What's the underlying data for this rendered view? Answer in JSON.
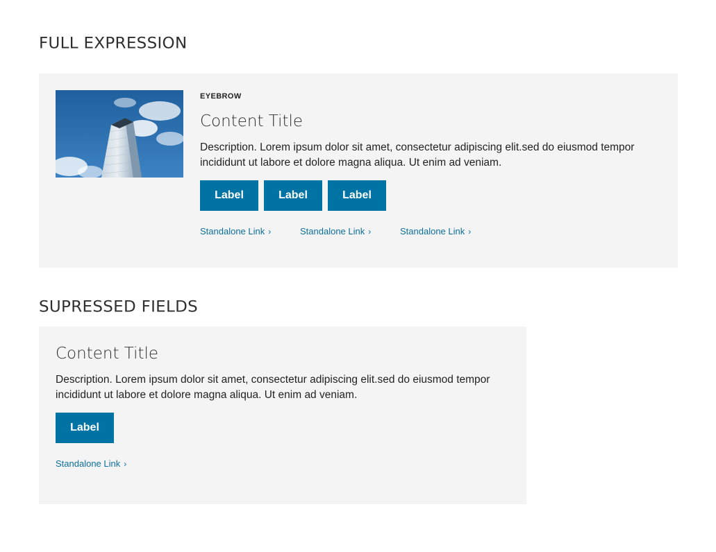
{
  "sections": {
    "full": {
      "heading": "FULL EXPRESSION",
      "eyebrow": "EYEBROW",
      "title": "Content Title",
      "description": "Description. Lorem ipsum dolor sit amet, consectetur adipiscing elit.sed do eiusmod tempor incididunt ut labore et dolore magna aliqua. Ut enim ad veniam.",
      "buttons": [
        "Label",
        "Label",
        "Label"
      ],
      "links": [
        "Standalone Link",
        "Standalone Link",
        "Standalone Link"
      ]
    },
    "suppressed": {
      "heading": "SUPRESSED FIELDS",
      "title": "Content Title",
      "description": "Description. Lorem ipsum dolor sit amet, consectetur adipiscing elit.sed do eiusmod tempor incididunt ut labore et dolore magna aliqua. Ut enim ad veniam.",
      "buttons": [
        "Label"
      ],
      "links": [
        "Standalone Link"
      ]
    }
  },
  "icons": {
    "link_chevron": "chevron-right-icon"
  },
  "colors": {
    "button": "#0073a5",
    "link": "#0c6f9e",
    "card_bg": "#f4f4f4"
  }
}
